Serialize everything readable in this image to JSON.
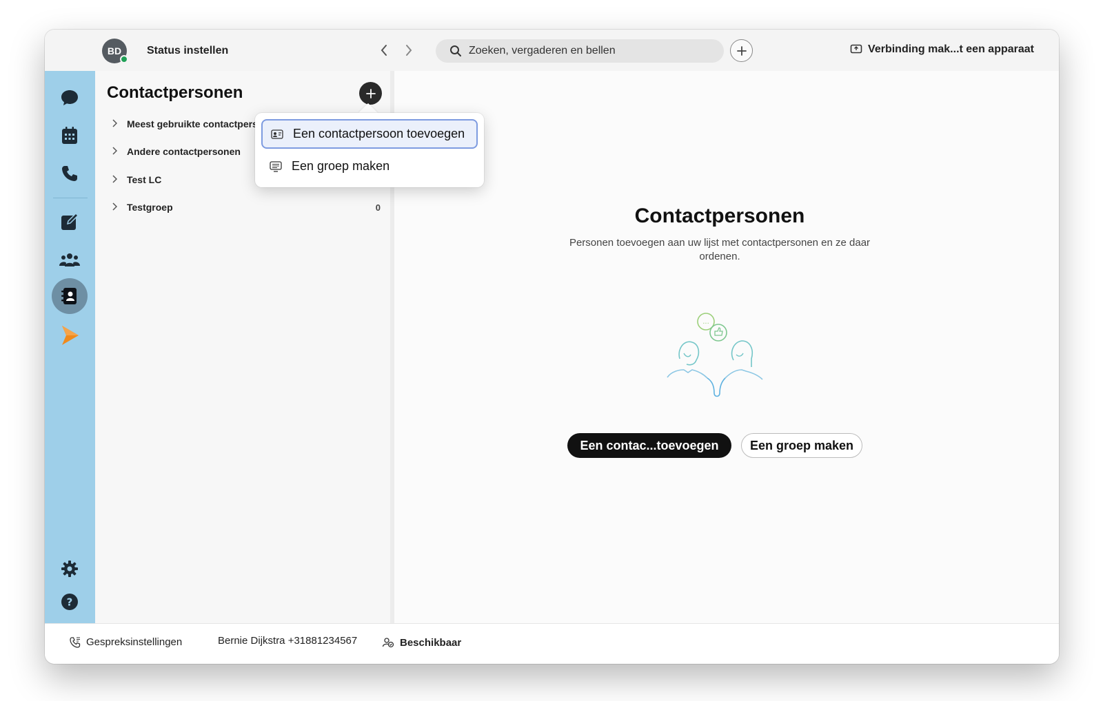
{
  "topbar": {
    "avatar_initials": "BD",
    "status_label": "Status instellen",
    "search_placeholder": "Zoeken, vergaderen en bellen",
    "connect_label": "Verbinding mak...t een apparaat"
  },
  "sidebar": {
    "items": [
      {
        "icon": "chat-icon"
      },
      {
        "icon": "calendar-icon"
      },
      {
        "icon": "phone-icon"
      },
      {
        "icon": "edit-icon"
      },
      {
        "icon": "teams-icon"
      },
      {
        "icon": "contacts-icon",
        "active": true
      },
      {
        "icon": "arrow-app-icon"
      },
      {
        "icon": "gear-icon"
      },
      {
        "icon": "help-icon"
      }
    ]
  },
  "contacts_panel": {
    "title": "Contactpersonen",
    "groups": [
      {
        "label": "Meest gebruikte contactpersonen",
        "count": ""
      },
      {
        "label": "Andere contactpersonen",
        "count": ""
      },
      {
        "label": "Test LC",
        "count": ""
      },
      {
        "label": "Testgroep",
        "count": "0"
      }
    ]
  },
  "popup_menu": {
    "items": [
      {
        "label": "Een contactpersoon toevoegen",
        "icon": "contact-card-icon",
        "selected": true
      },
      {
        "label": "Een groep maken",
        "icon": "group-list-icon",
        "selected": false
      }
    ]
  },
  "main": {
    "title": "Contactpersonen",
    "subtitle": "Personen toevoegen aan uw lijst met contactpersonen en ze daar ordenen.",
    "primary_button": "Een contac...toevoegen",
    "secondary_button": "Een groep maken"
  },
  "statusbar": {
    "call_settings": "Gespreksinstellingen",
    "user_line": "Bernie Dijkstra +31881234567",
    "availability": "Beschikbaar"
  },
  "colors": {
    "sidebar": "#9ecfe9",
    "presence": "#1fa056",
    "accent_selected": "#7d9be0"
  }
}
